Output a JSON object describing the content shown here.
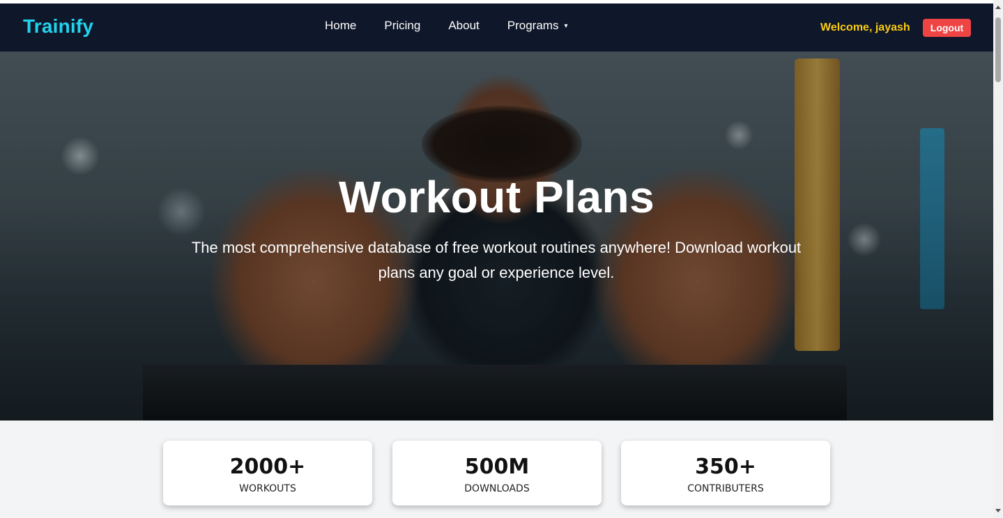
{
  "nav": {
    "brand": "Trainify",
    "links": [
      "Home",
      "Pricing",
      "About",
      "Programs"
    ],
    "programs_caret": "▾",
    "welcome": "Welcome, jayash",
    "logout": "Logout"
  },
  "hero": {
    "title": "Workout Plans",
    "subtitle": "The most comprehensive database of free workout routines anywhere! Download workout plans any goal or experience level."
  },
  "stats": [
    {
      "value": "2000+",
      "label": "WORKOUTS"
    },
    {
      "value": "500M",
      "label": "DOWNLOADS"
    },
    {
      "value": "350+",
      "label": "CONTRIBUTERS"
    }
  ],
  "colors": {
    "navbar_bg": "#0f172a",
    "brand": "#22d3ee",
    "welcome": "#facc15",
    "logout_bg": "#ef4444",
    "page_bg": "#f3f4f6"
  }
}
